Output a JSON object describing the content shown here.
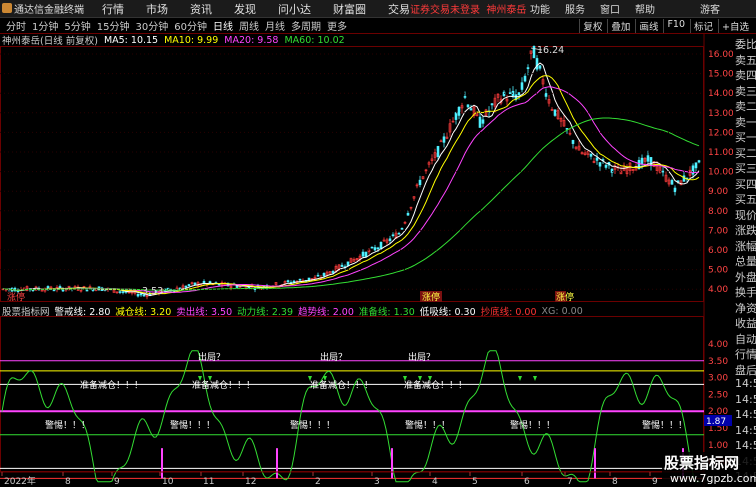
{
  "app": {
    "title": "通达信金融终端",
    "menu": [
      "行情",
      "市场",
      "资讯",
      "发现",
      "问小达",
      "财富圈",
      "交易"
    ],
    "notice": "证券交易未登录",
    "stock_name_top": "神州泰岳",
    "right_menu": [
      "功能",
      "服务",
      "窗口",
      "帮助",
      "游客"
    ]
  },
  "toolbar": {
    "periods": [
      "分时",
      "1分钟",
      "5分钟",
      "15分钟",
      "30分钟",
      "60分钟",
      "日线",
      "周线",
      "月线",
      "多周期",
      "更多"
    ],
    "active": "日线",
    "right": [
      "复权",
      "叠加",
      "画线",
      "F10",
      "标记",
      "+自选"
    ]
  },
  "ma_legend": [
    {
      "text": "神州泰岳(日线 前复权)",
      "color": "#cccccc"
    },
    {
      "text": "MA5: 10.15",
      "color": "#ffffff"
    },
    {
      "text": "MA10: 9.99",
      "color": "#ffff00"
    },
    {
      "text": "MA20: 9.58",
      "color": "#ff44ff"
    },
    {
      "text": "MA60: 10.02",
      "color": "#33dd33"
    }
  ],
  "sub_legend": [
    {
      "text": "股票指标网",
      "color": "#cccccc"
    },
    {
      "text": "警戒线: 2.80",
      "color": "#ffffff"
    },
    {
      "text": "减仓线: 3.20",
      "color": "#ffff00"
    },
    {
      "text": "卖出线: 3.50",
      "color": "#ff44ff"
    },
    {
      "text": "动力线: 2.39",
      "color": "#33dd33"
    },
    {
      "text": "趋势线: 2.00",
      "color": "#ff44ff"
    },
    {
      "text": "准备线: 1.30",
      "color": "#33dd33"
    },
    {
      "text": "低吸线: 0.30",
      "color": "#ffffff"
    },
    {
      "text": "抄底线: 0.00",
      "color": "#ff3333"
    },
    {
      "text": "XG: 0.00",
      "color": "#888888"
    }
  ],
  "main_axis": {
    "labels": [
      "16.00",
      "15.00",
      "14.00",
      "13.00",
      "12.00",
      "11.00",
      "10.00",
      "9.00",
      "8.00",
      "7.00",
      "6.00",
      "5.00",
      "4.00"
    ],
    "color": "#ff4444"
  },
  "sub_axis": {
    "labels": [
      "4.00",
      "3.50",
      "3.00",
      "2.50",
      "2.00",
      "1.50",
      "1.00",
      "0.50"
    ],
    "current": "1.87"
  },
  "annotations": {
    "high": "16.24",
    "low": "3.53",
    "limit_up": "涨停",
    "tag_left": "涨停",
    "signal1": "出局？",
    "signal2": "准备减仓！！！",
    "signal3": "警惕！！！"
  },
  "side_panel": [
    "委比",
    "卖五",
    "卖四",
    "卖三",
    "卖二",
    "卖一",
    "买一",
    "买二",
    "买三",
    "买四",
    "买五",
    "现价",
    "涨跌",
    "涨幅",
    "总量",
    "外盘",
    "换手",
    "净资",
    "收益",
    "自动",
    "行情",
    "盘后",
    "14:50",
    "14:50",
    "14:50",
    "14:50",
    "14:50",
    "14:50",
    "14:50"
  ],
  "date_axis": [
    "2022年",
    "8",
    "9",
    "10",
    "11",
    "12",
    "2",
    "3",
    "4",
    "5",
    "6",
    "7",
    "8",
    "9"
  ],
  "watermark": {
    "line1": "股票指标网",
    "line2": "www.7gpzb.com"
  }
}
